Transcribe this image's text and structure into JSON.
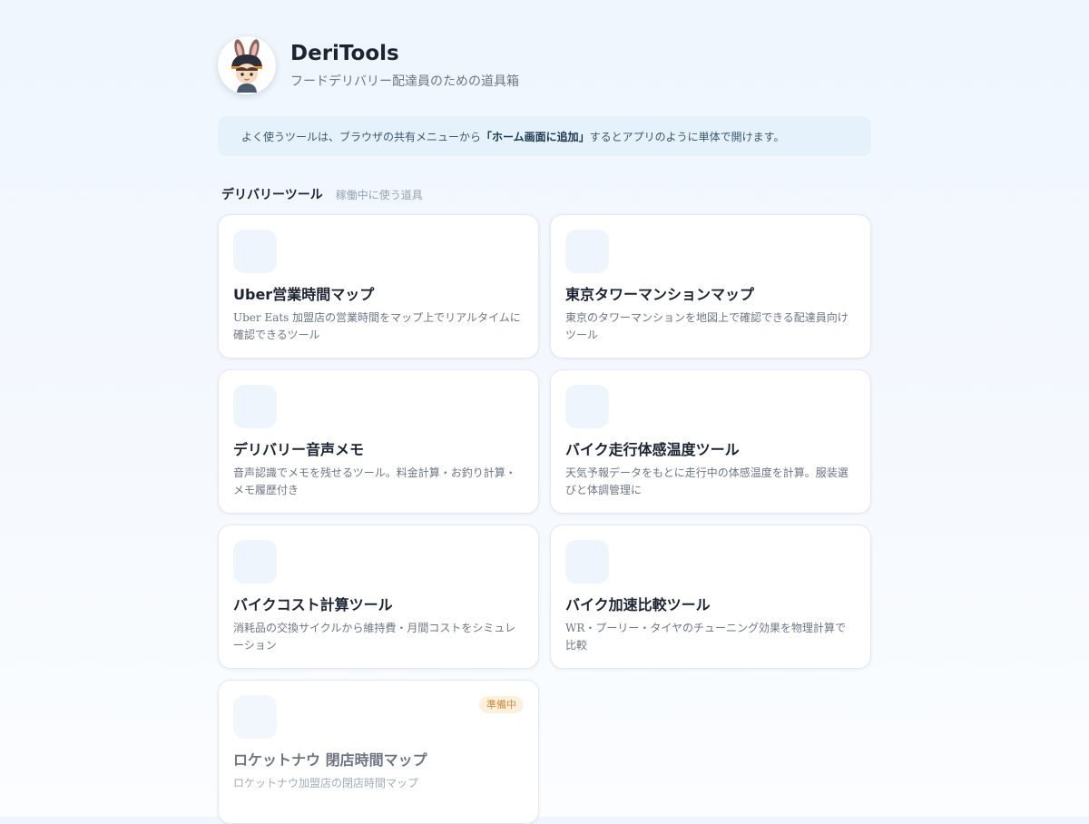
{
  "header": {
    "title": "DeriTools",
    "subtitle": "フードデリバリー配達員のための道具箱"
  },
  "notice": {
    "before": "よく使うツールは、ブラウザの共有メニューから",
    "emphasis": "「ホーム画面に追加」",
    "after": "するとアプリのように単体で開けます。"
  },
  "section": {
    "title": "デリバリーツール",
    "subtitle": "稼働中に使う道具"
  },
  "tools": [
    {
      "title": "Uber営業時間マップ",
      "description": "Uber Eats 加盟店の営業時間をマップ上でリアルタイムに確認できるツール"
    },
    {
      "title": "東京タワーマンションマップ",
      "description": "東京のタワーマンションを地図上で確認できる配達員向けツール"
    },
    {
      "title": "デリバリー音声メモ",
      "description": "音声認識でメモを残せるツール。料金計算・お釣り計算・メモ履歴付き"
    },
    {
      "title": "バイク走行体感温度ツール",
      "description": "天気予報データをもとに走行中の体感温度を計算。服装選びと体調管理に"
    },
    {
      "title": "バイクコスト計算ツール",
      "description": "消耗品の交換サイクルから維持費・月間コストをシミュレーション"
    },
    {
      "title": "バイク加速比較ツール",
      "description": "WR・プーリー・タイヤのチューニング効果を物理計算で比較"
    },
    {
      "title": "ロケットナウ 閉店時間マップ",
      "description": "ロケットナウ加盟店の閉店時間マップ",
      "badge": "準備中"
    }
  ],
  "colors": {
    "accent_bg": "#e5f2fc",
    "badge_bg": "#fdf1de",
    "badge_text": "#d0893a"
  }
}
